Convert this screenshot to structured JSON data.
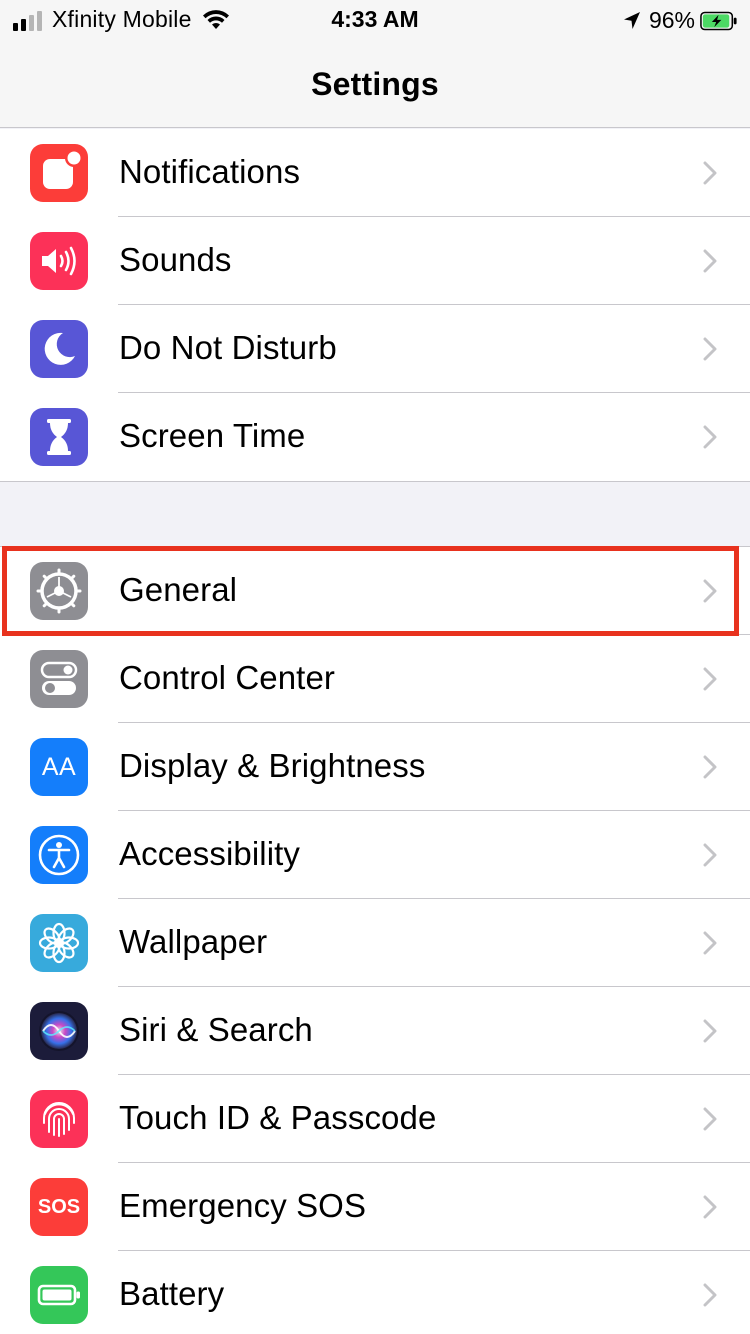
{
  "status_bar": {
    "carrier": "Xfinity Mobile",
    "time": "4:33 AM",
    "battery_percent": "96%",
    "signal_bars_filled": 2,
    "signal_bars_total": 4,
    "battery_level": 0.96,
    "battery_charging": true,
    "icons": [
      "signal-icon",
      "wifi-icon",
      "location-arrow-icon",
      "battery-charging-icon"
    ]
  },
  "nav": {
    "title": "Settings"
  },
  "groups": [
    {
      "items": [
        {
          "label": "Notifications",
          "icon": "notifications-icon",
          "color": "#fc3d39"
        },
        {
          "label": "Sounds",
          "icon": "sounds-icon",
          "color": "#fc3158"
        },
        {
          "label": "Do Not Disturb",
          "icon": "moon-icon",
          "color": "#5856d6"
        },
        {
          "label": "Screen Time",
          "icon": "hourglass-icon",
          "color": "#5856d6"
        }
      ]
    },
    {
      "items": [
        {
          "label": "General",
          "icon": "gear-icon",
          "color": "#8e8e93",
          "highlighted": true
        },
        {
          "label": "Control Center",
          "icon": "toggles-icon",
          "color": "#8e8e93"
        },
        {
          "label": "Display & Brightness",
          "icon": "text-size-icon",
          "color": "#147efb",
          "icon_text": "AA"
        },
        {
          "label": "Accessibility",
          "icon": "accessibility-icon",
          "color": "#147efb"
        },
        {
          "label": "Wallpaper",
          "icon": "flower-icon",
          "color": "#37aadc"
        },
        {
          "label": "Siri & Search",
          "icon": "siri-icon",
          "color": "#1c1c3a"
        },
        {
          "label": "Touch ID & Passcode",
          "icon": "fingerprint-icon",
          "color": "#fc3158"
        },
        {
          "label": "Emergency SOS",
          "icon": "sos-icon",
          "color": "#fc3d39",
          "icon_text": "SOS"
        },
        {
          "label": "Battery",
          "icon": "battery-icon",
          "color": "#34c759"
        }
      ]
    }
  ],
  "highlight": {
    "color": "#e8321e"
  }
}
